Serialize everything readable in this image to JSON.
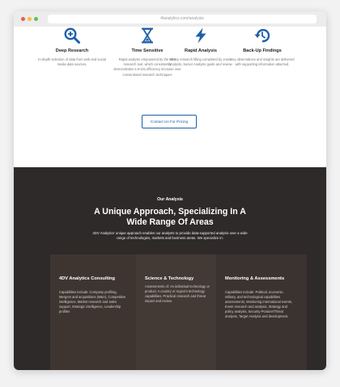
{
  "browser": {
    "url": "4lanalytics.com/analysis"
  },
  "features": [
    {
      "icon": "magnifier-plus-icon",
      "title": "Deep Research",
      "description": "In-depth selection of data from web and social media data sources."
    },
    {
      "icon": "hourglass-icon",
      "title": "Time Sensitive",
      "description": "Rapid analysis empowered by the 4DV research tool, which consistently demonstrates a 9-10x efficiency increase over conventional research techniques"
    },
    {
      "icon": "lightning-bolt-icon",
      "title": "Rapid Analysis",
      "description": "Heavy research lifting completed by Junior Analysts, Senior Analysts guide and review."
    },
    {
      "icon": "history-arrow-icon",
      "title": "Back-Up Findings",
      "description": "Key observations and insights are delivered with supporting information attached."
    }
  ],
  "cta": {
    "label": "Contact Us For Pricing"
  },
  "analysis": {
    "eyebrow": "Our Analysis",
    "heading": "A Unique Approach, Specializing In A Wide Range Of Areas",
    "intro": "4DV Analytics' unique approach enables our analysts to provide data-supported analysis over a wide range of technologies, markets and business areas. We specialize in:",
    "cards": [
      {
        "title": "4DV Analytics Consulting",
        "body": "Capabilities include: Company profiling, Mergers and acquisitions (M&A), Competitive intelligence, Market research and sales support, Strategic intelligence, Leadership profiles"
      },
      {
        "title": "Science & Technology",
        "body": "Assessments of: An individual technology or product, A country or region's technology capabilities, Practical research and threat impact and review."
      },
      {
        "title": "Monitoring & Assessments",
        "body": "Capabilities include: Political, economic, military, and technological capabilities assessments, Monitoring international events, Event research and analysis, Strategy and policy analysis, Security-Posture/Threat analysis, Target Analysis and development."
      }
    ]
  },
  "colors": {
    "accent": "#1e5fa8",
    "dark_section": "#2e2a29"
  }
}
